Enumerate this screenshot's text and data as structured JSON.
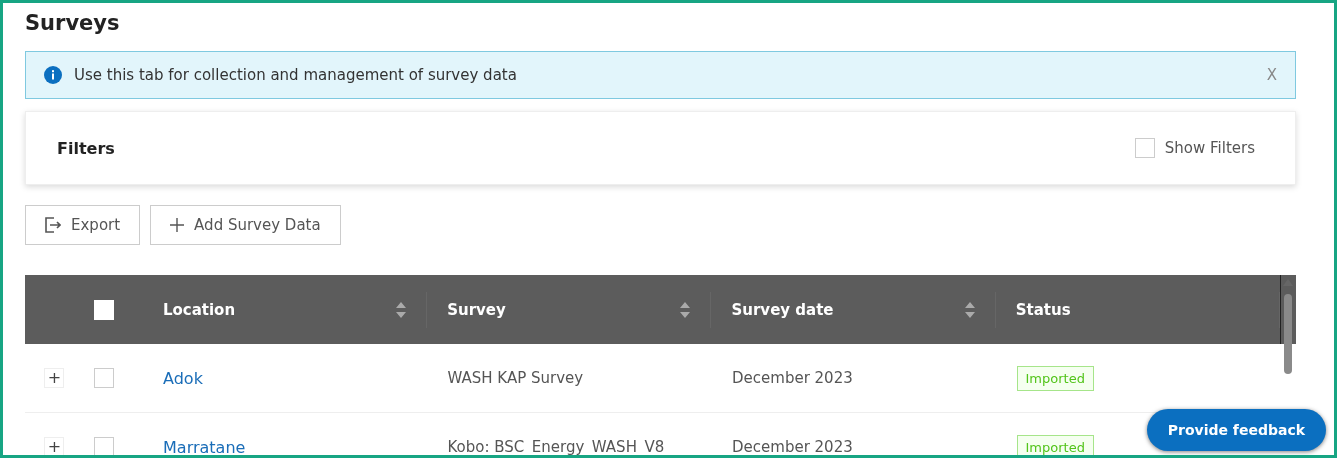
{
  "page": {
    "title": "Surveys"
  },
  "banner": {
    "text": "Use this tab for collection and management of survey data",
    "close": "X"
  },
  "filters": {
    "title": "Filters",
    "toggle": {
      "label": "Show Filters",
      "checked": false
    }
  },
  "actions": [
    {
      "kind": "export",
      "label": "Export"
    },
    {
      "kind": "add",
      "label": "Add Survey Data"
    }
  ],
  "table": {
    "select_all": {
      "checked": false
    },
    "columns": [
      {
        "label": "Location",
        "sortable": true
      },
      {
        "label": "Survey",
        "sortable": true
      },
      {
        "label": "Survey date",
        "sortable": true
      },
      {
        "label": "Status",
        "sortable": false
      }
    ],
    "rows": [
      {
        "expand": "+",
        "checked": false,
        "location": "Adok",
        "survey": "WASH KAP Survey",
        "date": "December 2023",
        "status": "Imported"
      },
      {
        "expand": "+",
        "checked": false,
        "location": "Marratane",
        "survey": "Kobo: BSC_Energy_WASH_V8",
        "date": "December 2023",
        "status": "Imported"
      }
    ]
  },
  "feedback": {
    "label": "Provide feedback"
  }
}
